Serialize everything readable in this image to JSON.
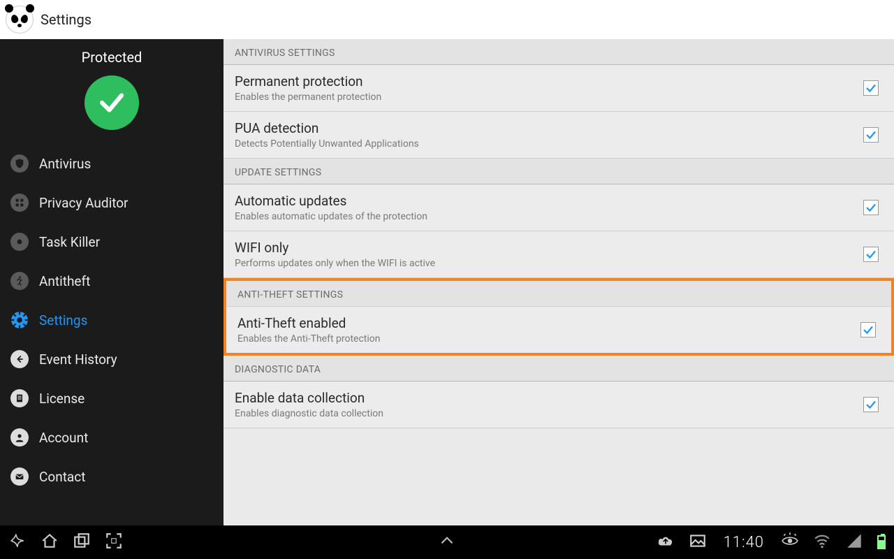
{
  "appBar": {
    "title": "Settings"
  },
  "sidebar": {
    "statusLabel": "Protected",
    "items": [
      {
        "label": "Antivirus"
      },
      {
        "label": "Privacy Auditor"
      },
      {
        "label": "Task Killer"
      },
      {
        "label": "Antitheft"
      },
      {
        "label": "Settings"
      },
      {
        "label": "Event History"
      },
      {
        "label": "License"
      },
      {
        "label": "Account"
      },
      {
        "label": "Contact"
      }
    ]
  },
  "sections": [
    {
      "header": "ANTIVIRUS SETTINGS",
      "rows": [
        {
          "title": "Permanent protection",
          "sub": "Enables the permanent protection",
          "checked": true
        },
        {
          "title": "PUA detection",
          "sub": "Detects Potentially Unwanted Applications",
          "checked": true
        }
      ]
    },
    {
      "header": "UPDATE SETTINGS",
      "rows": [
        {
          "title": "Automatic updates",
          "sub": "Enables automatic updates of the protection",
          "checked": true
        },
        {
          "title": "WIFI only",
          "sub": "Performs updates only when the WIFI is active",
          "checked": true
        }
      ]
    },
    {
      "header": "ANTI-THEFT SETTINGS",
      "highlight": true,
      "rows": [
        {
          "title": "Anti-Theft enabled",
          "sub": "Enables the Anti-Theft protection",
          "checked": true
        }
      ]
    },
    {
      "header": "DIAGNOSTIC DATA",
      "rows": [
        {
          "title": "Enable data collection",
          "sub": "Enables diagnostic data collection",
          "checked": true
        }
      ]
    }
  ],
  "statusBar": {
    "time": "11:40"
  }
}
